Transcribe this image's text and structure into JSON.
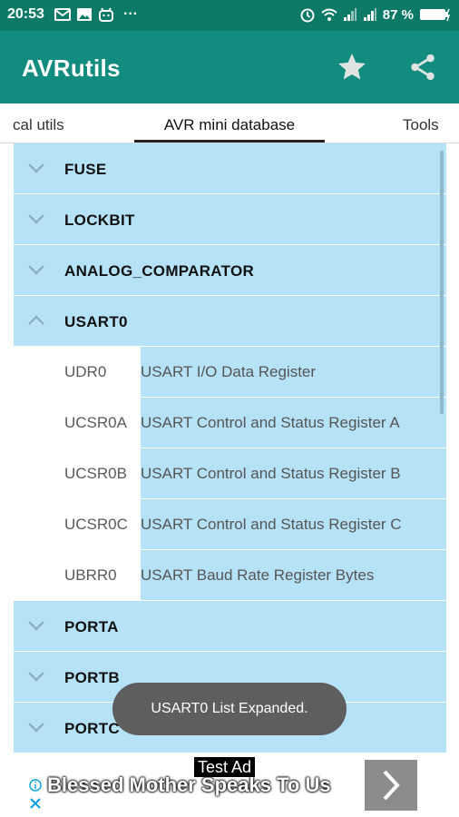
{
  "status_bar": {
    "time": "20:53",
    "battery": "87 %",
    "left_icons": [
      "mail-icon",
      "image-icon",
      "android-icon"
    ],
    "more": "···",
    "right_icons": [
      "alarm-icon",
      "wifi-icon",
      "signal-icon",
      "signal-icon",
      "battery-icon"
    ]
  },
  "app_bar": {
    "title": "AVRutils",
    "actions": [
      "star-icon",
      "share-icon"
    ],
    "bg_color": "#128c7e"
  },
  "tabs": [
    {
      "label": "cal utils",
      "selected": false
    },
    {
      "label": "AVR mini database",
      "selected": true
    },
    {
      "label": "Tools",
      "selected": false
    }
  ],
  "list": {
    "accent_color": "#b6e2f7",
    "groups_before": [
      {
        "label": "FUSE",
        "expanded": false
      },
      {
        "label": "LOCKBIT",
        "expanded": false
      },
      {
        "label": "ANALOG_COMPARATOR",
        "expanded": false
      }
    ],
    "expanded_group": {
      "label": "USART0",
      "expanded": true,
      "children": [
        {
          "name": "UDR0",
          "desc": "USART I/O Data Register"
        },
        {
          "name": "UCSR0A",
          "desc": "USART Control and Status Register A"
        },
        {
          "name": "UCSR0B",
          "desc": "USART Control and Status Register B"
        },
        {
          "name": "UCSR0C",
          "desc": "USART Control and Status Register C"
        },
        {
          "name": "UBRR0",
          "desc": "USART Baud Rate Register  Bytes"
        }
      ]
    },
    "groups_after": [
      {
        "label": "PORTA",
        "expanded": false
      },
      {
        "label": "PORTB",
        "expanded": false
      },
      {
        "label": "PORTC",
        "expanded": false
      }
    ]
  },
  "toast": {
    "message": "USART0 List Expanded."
  },
  "ad": {
    "tag": "Test Ad",
    "title": "Blessed Mother Speaks To Us",
    "icons": [
      "info-icon",
      "close-icon",
      "chevron-right-icon"
    ]
  }
}
